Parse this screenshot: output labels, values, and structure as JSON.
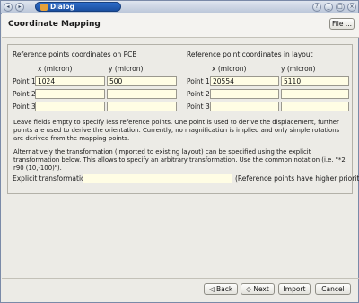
{
  "window": {
    "title": "Dialog",
    "controls": [
      "?",
      "_",
      "□",
      "×"
    ]
  },
  "header": {
    "title": "Coordinate Mapping",
    "file_button": "File ..."
  },
  "pcb": {
    "heading": "Reference points coordinates on PCB",
    "col_x": "x (micron)",
    "col_y": "y (micron)",
    "rows": [
      {
        "label": "Point 1",
        "x": "1024",
        "y": "500"
      },
      {
        "label": "Point 2",
        "x": "",
        "y": ""
      },
      {
        "label": "Point 3",
        "x": "",
        "y": ""
      }
    ]
  },
  "layout": {
    "heading": "Reference point coordinates in layout",
    "col_x": "x (micron)",
    "col_y": "y (micron)",
    "rows": [
      {
        "label": "Point 1",
        "x": "20554",
        "y": "5110"
      },
      {
        "label": "Point 2",
        "x": "",
        "y": ""
      },
      {
        "label": "Point 3",
        "x": "",
        "y": ""
      }
    ]
  },
  "help1": "Leave fields empty to specify less reference points. One point is used to derive the displacement, further points are used to derive the orientation. Currently, no magnification is implied and only simple rotations are derived from the mapping points.",
  "help2": "Alternatively the transformation (imported to existing layout) can be specified using the explicit transformation below. This allows to specify an arbitrary transformation. Use the common notation (i.e. \"*2 r90 (10,-100)\").",
  "explicit": {
    "label": "Explicit transformation",
    "value": "",
    "note": "(Reference points have higher priority)"
  },
  "footer": {
    "back": "Back",
    "next": "Next",
    "import": "Import",
    "cancel": "Cancel"
  }
}
